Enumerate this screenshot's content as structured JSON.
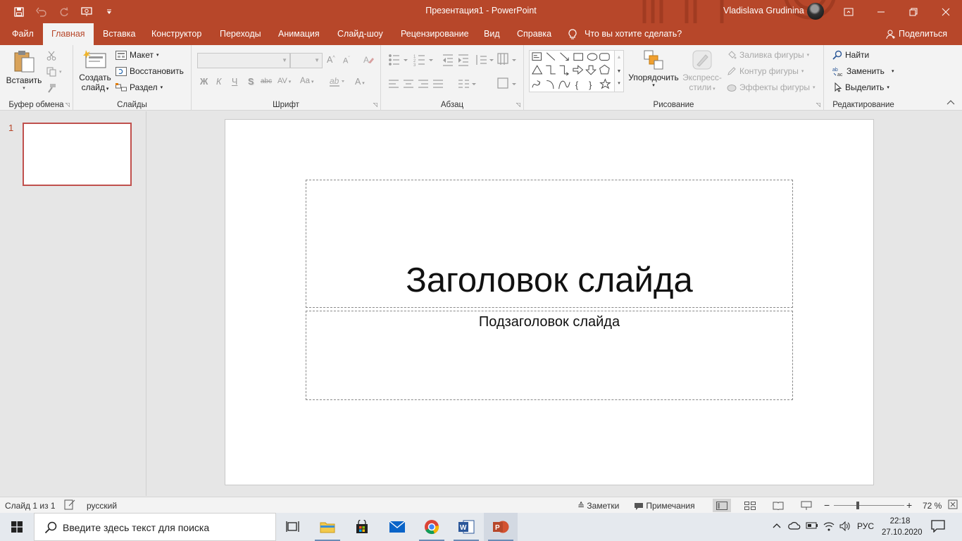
{
  "titlebar": {
    "title": "Презентация1  -  PowerPoint",
    "user": "Vladislava Grudinina",
    "qat_icons": [
      "save-icon",
      "undo-icon",
      "redo-icon",
      "start-presentation-icon",
      "customize-qat-icon"
    ],
    "window_buttons": [
      "ribbon-display-options-icon",
      "minimize-icon",
      "restore-icon",
      "close-icon"
    ]
  },
  "tabs": [
    "Файл",
    "Главная",
    "Вставка",
    "Конструктор",
    "Переходы",
    "Анимация",
    "Слайд-шоу",
    "Рецензирование",
    "Вид",
    "Справка"
  ],
  "active_tab": "Главная",
  "tellme": "Что вы хотите сделать?",
  "share": "Поделиться",
  "ribbon": {
    "clipboard": {
      "label": "Буфер обмена",
      "paste": "Вставить"
    },
    "slides": {
      "label": "Слайды",
      "new_slide_line1": "Создать",
      "new_slide_line2": "слайд",
      "layout": "Макет",
      "reset": "Восстановить",
      "section": "Раздел"
    },
    "font": {
      "label": "Шрифт",
      "bold": "Ж",
      "italic": "К",
      "underline": "Ч",
      "shadow": "S",
      "strike": "abc",
      "spacing": "AV",
      "case": "Aa",
      "grow": "A",
      "shrink": "A",
      "color": "A"
    },
    "paragraph": {
      "label": "Абзац"
    },
    "drawing": {
      "label": "Рисование",
      "arrange": "Упорядочить",
      "quick_styles_line1": "Экспресс-",
      "quick_styles_line2": "стили",
      "fill": "Заливка фигуры",
      "outline": "Контур фигуры",
      "effects": "Эффекты фигуры"
    },
    "editing": {
      "label": "Редактирование",
      "find": "Найти",
      "replace": "Заменить",
      "select": "Выделить"
    }
  },
  "thumbnails": {
    "number": "1"
  },
  "slide": {
    "title": "Заголовок слайда",
    "subtitle": "Подзаголовок слайда"
  },
  "statusbar": {
    "slide_info": "Слайд 1 из 1",
    "language": "русский",
    "notes": "Заметки",
    "comments": "Примечания",
    "zoom": "72 %",
    "zoom_minus": "−",
    "zoom_plus": "+"
  },
  "taskbar": {
    "search_placeholder": "Введите здесь текст для поиска",
    "apps": [
      "task-view-icon",
      "file-explorer-icon",
      "store-icon",
      "mail-icon",
      "chrome-icon",
      "word-icon",
      "powerpoint-icon"
    ],
    "language": "РУС",
    "time": "22:18",
    "date": "27.10.2020"
  },
  "colors": {
    "accent": "#b7472a",
    "ribbon": "#f3f3f3",
    "workspace": "#e6e6e6",
    "selection": "#c0504d"
  }
}
